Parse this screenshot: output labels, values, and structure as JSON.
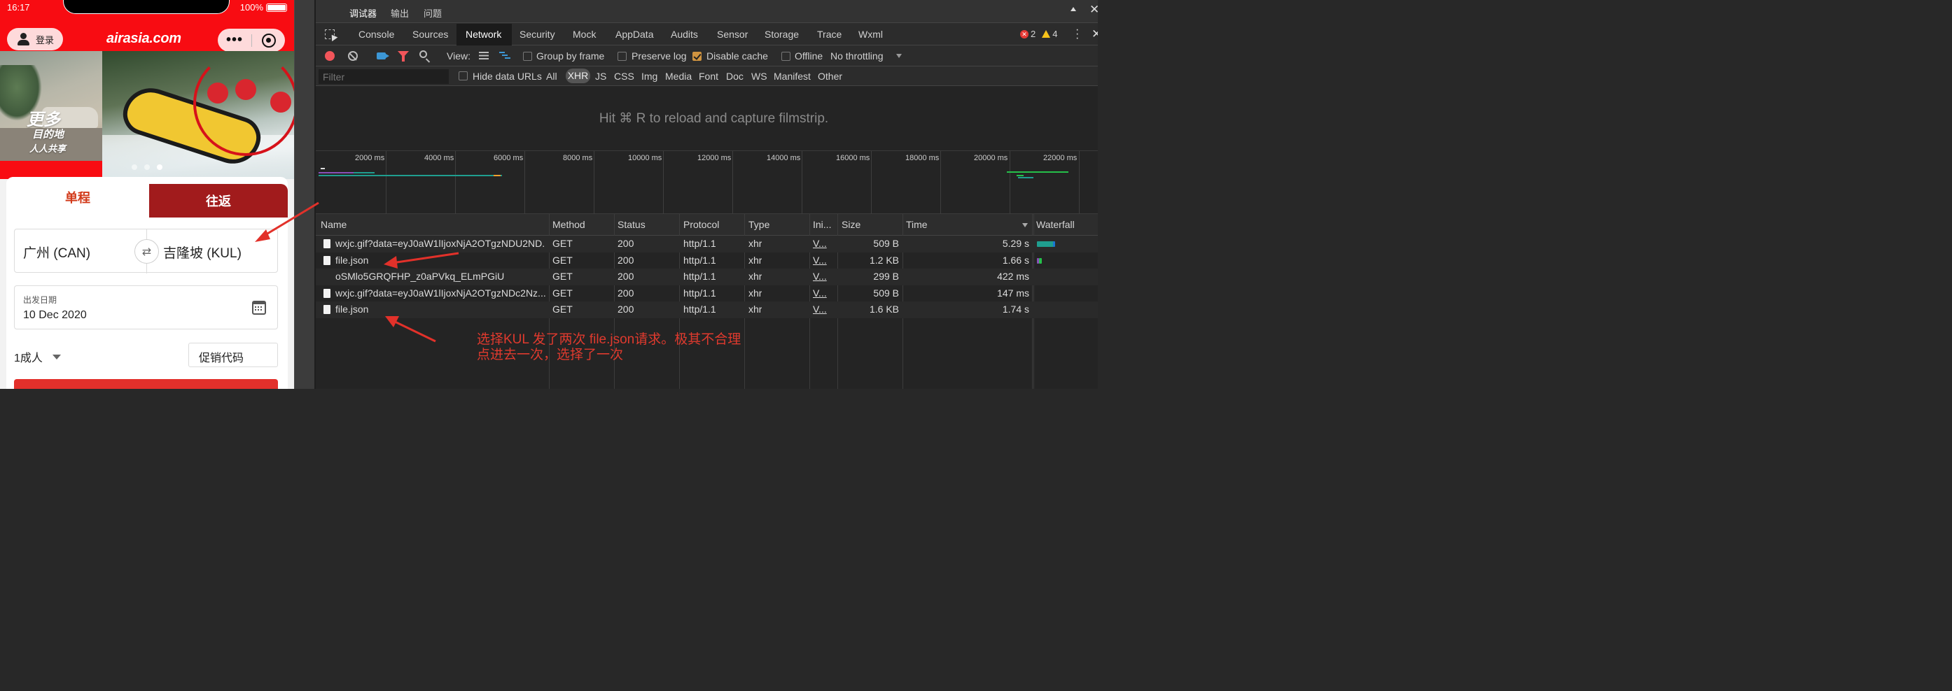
{
  "phone": {
    "status_time": "16:17",
    "battery_text": "100%",
    "login_label": "登录",
    "brand": "airasia.com",
    "capsule_dots": "•••",
    "banner": {
      "line1": "更多",
      "line2": "目的地",
      "line3": "人人共享",
      "slide_count": 3,
      "active_slide": 3
    },
    "tabs": {
      "one_way": "单程",
      "round_trip": "往返"
    },
    "route": {
      "from": "广州 (CAN)",
      "to": "吉隆坡 (KUL)",
      "swap_symbol": "⇄"
    },
    "date": {
      "label": "出发日期",
      "value": "10 Dec 2020"
    },
    "passengers": "1成人",
    "promo_placeholder": "促销代码",
    "colors": {
      "brand_red": "#f80c12",
      "accent_red": "#e2302b",
      "tab_dark": "#a11b1c"
    }
  },
  "devtools": {
    "top_tabs": [
      "调试器",
      "输出",
      "问题"
    ],
    "panel_tabs": [
      "Console",
      "Sources",
      "Network",
      "Security",
      "Mock",
      "AppData",
      "Audits",
      "Sensor",
      "Storage",
      "Trace",
      "Wxml"
    ],
    "active_panel": "Network",
    "errors_count": "2",
    "warnings_count": "4",
    "toolbar": {
      "view_label": "View:",
      "group_by_frame": "Group by frame",
      "preserve_log": "Preserve log",
      "disable_cache": "Disable cache",
      "offline": "Offline",
      "throttling": "No throttling"
    },
    "filter_bar": {
      "placeholder": "Filter",
      "hide_data_urls": "Hide data URLs",
      "types": [
        "All",
        "XHR",
        "JS",
        "CSS",
        "Img",
        "Media",
        "Font",
        "Doc",
        "WS",
        "Manifest",
        "Other"
      ],
      "active_type": "XHR"
    },
    "filmstrip_message": "Hit ⌘ R to reload and capture filmstrip.",
    "overview_ticks": [
      "2000 ms",
      "4000 ms",
      "6000 ms",
      "8000 ms",
      "10000 ms",
      "12000 ms",
      "14000 ms",
      "16000 ms",
      "18000 ms",
      "20000 ms",
      "22000 ms"
    ],
    "columns": [
      "Name",
      "Method",
      "Status",
      "Protocol",
      "Type",
      "Ini...",
      "Size",
      "Time",
      "Waterfall"
    ],
    "rows": [
      {
        "name": "wxjc.gif?data=eyJ0aW1lIjoxNjA2OTgzNDU2ND...",
        "method": "GET",
        "status": "200",
        "protocol": "http/1.1",
        "type": "xhr",
        "initiator": "V...",
        "size": "509 B",
        "time": "5.29 s",
        "icon": true
      },
      {
        "name": "file.json",
        "method": "GET",
        "status": "200",
        "protocol": "http/1.1",
        "type": "xhr",
        "initiator": "V...",
        "size": "1.2 KB",
        "time": "1.66 s",
        "icon": true
      },
      {
        "name": "oSMlo5GRQFHP_z0aPVkq_ELmPGiU",
        "method": "GET",
        "status": "200",
        "protocol": "http/1.1",
        "type": "xhr",
        "initiator": "V...",
        "size": "299 B",
        "time": "422 ms",
        "icon": false
      },
      {
        "name": "wxjc.gif?data=eyJ0aW1lIjoxNjA2OTgzNDc2Nz...",
        "method": "GET",
        "status": "200",
        "protocol": "http/1.1",
        "type": "xhr",
        "initiator": "V...",
        "size": "509 B",
        "time": "147 ms",
        "icon": true
      },
      {
        "name": "file.json",
        "method": "GET",
        "status": "200",
        "protocol": "http/1.1",
        "type": "xhr",
        "initiator": "V...",
        "size": "1.6 KB",
        "time": "1.74 s",
        "icon": true
      }
    ],
    "annotation": {
      "line1": "选择KUL 发了两次 file.json请求。极其不合理",
      "line2": "点进去一次，选择了一次"
    },
    "colors": {
      "annotation_red": "#e03a2e",
      "record_red": "#f2555a",
      "waterfall_teal": "#1f9e8f"
    }
  }
}
